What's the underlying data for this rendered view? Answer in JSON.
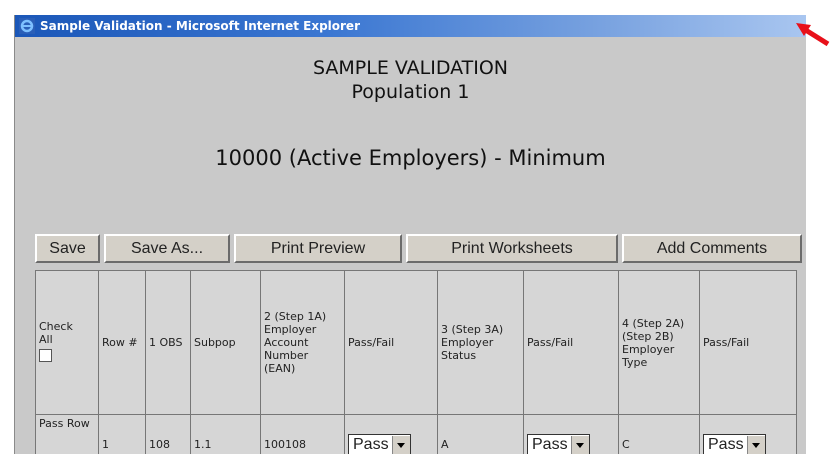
{
  "window": {
    "title": "Sample Validation - Microsoft Internet Explorer"
  },
  "page": {
    "heading_line1": "SAMPLE VALIDATION",
    "heading_line2": "Population 1",
    "subheading": "10000 (Active Employers) - Minimum"
  },
  "toolbar": {
    "save": "Save",
    "save_as": "Save As...",
    "print_preview": "Print Preview",
    "print_worksheets": "Print Worksheets",
    "add_comments": "Add Comments"
  },
  "table": {
    "headers": {
      "check_all": "Check All",
      "row": "Row #",
      "obs": "1 OBS",
      "subpop": "Subpop",
      "ean": "2 (Step 1A) Employer Account Number (EAN)",
      "passfail1": "Pass/Fail",
      "status": "3 (Step 3A) Employer Status",
      "passfail2": "Pass/Fail",
      "type": "4 (Step 2A) (Step 2B) Employer Type",
      "passfail3": "Pass/Fail"
    },
    "row1": {
      "pass_row": "Pass Row",
      "row": "1",
      "obs": "108",
      "subpop": "1.1",
      "ean": "100108",
      "pf1": "Pass",
      "status": "A",
      "pf2": "Pass",
      "type": "C",
      "pf3": "Pass"
    }
  },
  "colors": {
    "title_bar": "#1b57b8",
    "annotation_arrow": "#e8101a",
    "background": "#c9c9c9"
  },
  "icons": [
    "ie-icon",
    "checkbox-icon",
    "dropdown-arrow-icon",
    "red-arrow-icon"
  ]
}
